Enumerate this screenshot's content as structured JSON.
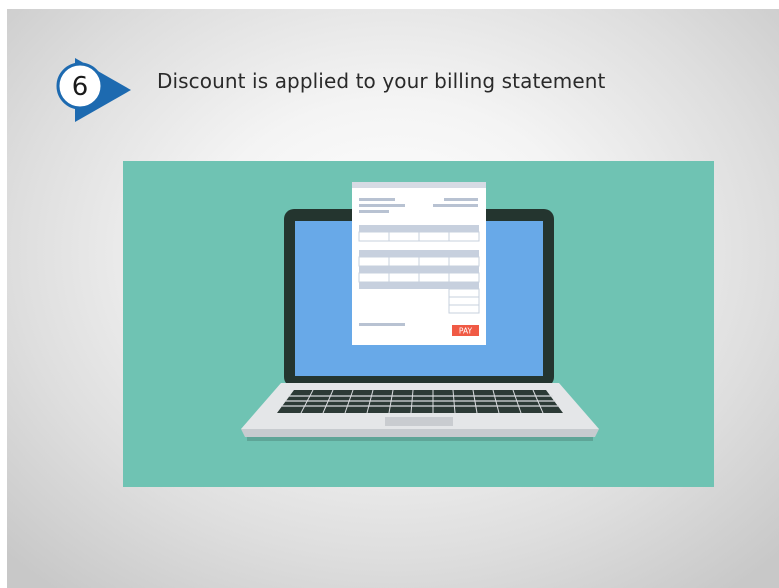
{
  "step": {
    "number": "6",
    "title": "Discount is applied to your billing statement"
  },
  "illustration": {
    "pay_button_label": "PAY",
    "icon": "laptop-invoice-illustration"
  },
  "colors": {
    "illustration_bg": "#6fc3b3",
    "screen_blue": "#68a9e8",
    "badge_blue": "#1d6ab0",
    "pay_red": "#f05a45"
  }
}
